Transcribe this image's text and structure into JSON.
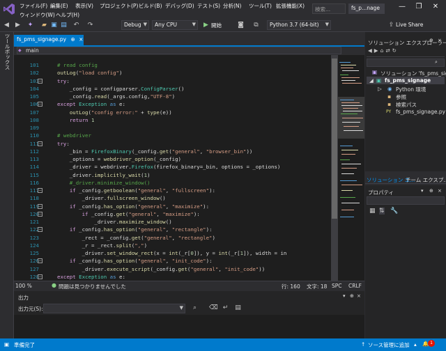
{
  "menu": {
    "row1": [
      "ファイル(F)",
      "編集(E)",
      "表示(V)",
      "プロジェクト(P)",
      "ビルド(B)",
      "デバッグ(D)",
      "テスト(S)",
      "分析(N)",
      "ツール(T)",
      "拡張機能(X)"
    ],
    "row2": [
      "ウィンドウ(W)",
      "ヘルプ(H)"
    ]
  },
  "search_placeholder": "検索...",
  "window_title": "fs_p...nage",
  "toolbar": {
    "config": "Debug",
    "platform": "Any CPU",
    "start_label": "開始",
    "python_env": "Python 3.7 (64-bit)",
    "live_share": "Live Share"
  },
  "toolbox_label": "ツールボックス",
  "doc_tab": {
    "title": "fs_pms_signage.py",
    "pin": "⊕",
    "close": "×"
  },
  "nav_combo": "main",
  "code_lines": [
    {
      "n": "101",
      "t": "        # read config"
    },
    {
      "n": "102",
      "t": "        outLog(\"load config\")"
    },
    {
      "n": "103",
      "t": "        try:"
    },
    {
      "n": "104",
      "t": "            _config = configparser.ConfigParser()"
    },
    {
      "n": "105",
      "t": "            _config.read(_args.config,\"UTF-8\")"
    },
    {
      "n": "106",
      "t": "        except Exception as e:"
    },
    {
      "n": "107",
      "t": "            outLog(\"config error:\" + type(e))"
    },
    {
      "n": "108",
      "t": "            return 1"
    },
    {
      "n": "109",
      "t": ""
    },
    {
      "n": "110",
      "t": "        # webdriver"
    },
    {
      "n": "111",
      "t": "        try:"
    },
    {
      "n": "112",
      "t": "            _bin = FirefoxBinary(_config.get(\"general\", \"browser_bin\"))"
    },
    {
      "n": "113",
      "t": "            _options = webdriver_option(_config)"
    },
    {
      "n": "114",
      "t": "            _driver = webdriver.Firefox(firefox_binary=_bin, options = _options)"
    },
    {
      "n": "115",
      "t": "            _driver.implicitly_wait(1)"
    },
    {
      "n": "116",
      "t": "            #_driver.minimize_window()"
    },
    {
      "n": "117",
      "t": "            if _config.getboolean(\"general\", \"fullscreen\"):"
    },
    {
      "n": "118",
      "t": "                _driver.fullscreen_window()"
    },
    {
      "n": "119",
      "t": "            if _config.has_option(\"general\", \"maximize\"):"
    },
    {
      "n": "120",
      "t": "                if _config.get(\"general\", \"maximize\"):"
    },
    {
      "n": "121",
      "t": "                    _driver.maximize_window()"
    },
    {
      "n": "122",
      "t": "            if _config.has_option(\"general\", \"rectangle\"):"
    },
    {
      "n": "123",
      "t": "                _rect = _config.get(\"general\", \"rectangle\")"
    },
    {
      "n": "124",
      "t": "                _r = _rect.split(\",\")"
    },
    {
      "n": "125",
      "t": "                _driver.set_window_rect(x = int(_r[0]), y = int(_r[1]), width = in"
    },
    {
      "n": "126",
      "t": "            if _config.has_option(\"general\", \"init_code\"):"
    },
    {
      "n": "127",
      "t": "                _driver.execute_script(_config.get(\"general\", \"init_code\"))"
    },
    {
      "n": "128",
      "t": "        except Exception as e:"
    }
  ],
  "editor_status": {
    "zoom": "100 %",
    "issues": "問題は見つかりませんでした",
    "line": "行: 160",
    "col": "文字: 18",
    "spc": "SPC",
    "crlf": "CRLF"
  },
  "output": {
    "title": "出力",
    "source_label": "出力元(S):"
  },
  "solution_explorer": {
    "title": "ソリューション エクスプローラー",
    "solution": "ソリューション 'fs_pms_signag",
    "project": "fs_pms_signage",
    "items": [
      "Python 環境",
      "参照",
      "検索パス",
      "fs_pms_signage.py"
    ],
    "tab1": "ソリューション エ...",
    "tab2": "チーム エクスプ..."
  },
  "properties": {
    "title": "プロパティ"
  },
  "statusbar": {
    "ready": "準備完了",
    "source_control": "ソース管理に追加",
    "notif_count": "1"
  }
}
